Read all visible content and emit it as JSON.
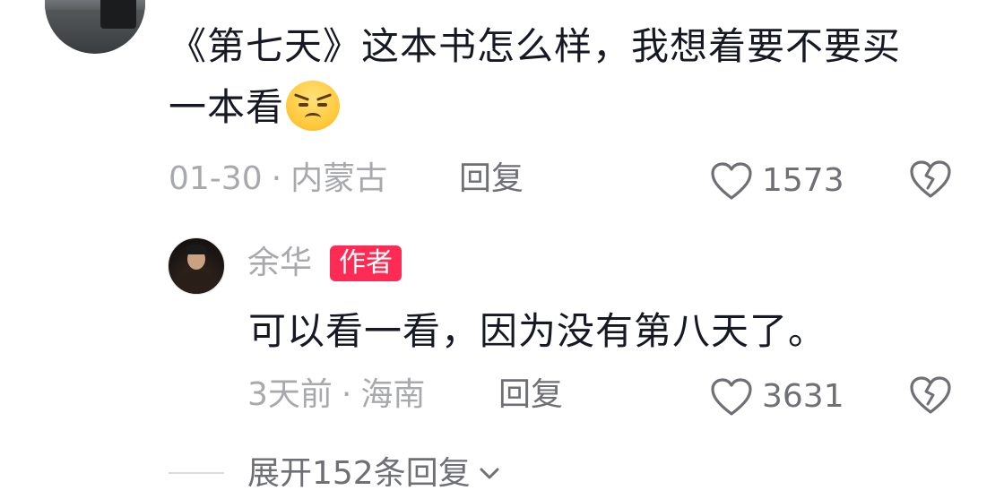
{
  "comment": {
    "text_line1": "《第七天》这本书怎么样，我想着要不要买",
    "text_line2": "一本看",
    "emoji": "annoyed-face-emoji",
    "date": "01-30",
    "separator": "·",
    "location": "内蒙古",
    "reply_label": "回复",
    "like_count": "1573",
    "like_icon": "heart-outline-icon",
    "dislike_icon": "broken-heart-icon"
  },
  "reply": {
    "author_name": "余华",
    "author_badge": "作者",
    "text": "可以看一看，因为没有第八天了。",
    "time": "3天前",
    "separator": "·",
    "location": "海南",
    "reply_label": "回复",
    "like_count": "3631",
    "like_icon": "heart-outline-icon",
    "dislike_icon": "broken-heart-icon"
  },
  "expand": {
    "label": "展开152条回复",
    "icon": "chevron-down-icon"
  },
  "colors": {
    "text_primary": "#161823",
    "text_secondary": "#a8a9ad",
    "text_action": "#6f7075",
    "badge_bg": "#fe2c55"
  }
}
